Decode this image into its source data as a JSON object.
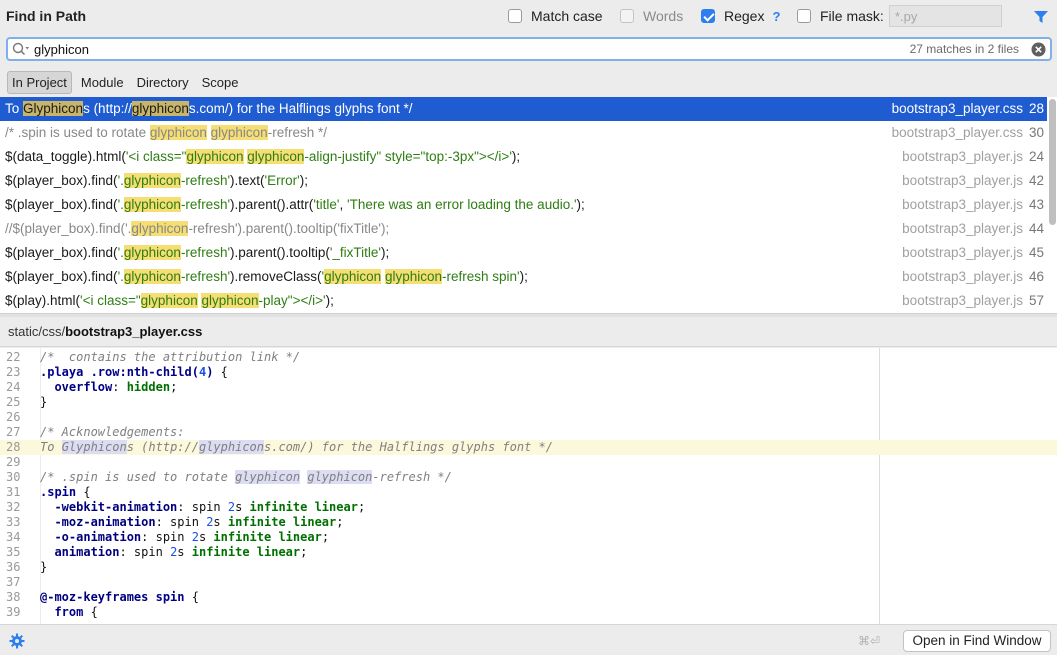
{
  "header": {
    "title": "Find in Path",
    "options": {
      "match_case": {
        "label": "Match case",
        "checked": false
      },
      "words": {
        "label": "Words",
        "checked": false,
        "enabled": false
      },
      "regex": {
        "label": "Regex",
        "checked": true,
        "help": "?"
      },
      "file_mask": {
        "label": "File mask:",
        "checked": false,
        "placeholder": "*.py"
      }
    }
  },
  "search": {
    "value": "glyphicon",
    "match_count": "27 matches in 2 files"
  },
  "scopes": [
    {
      "label": "In Project",
      "active": true
    },
    {
      "label": "Module",
      "active": false
    },
    {
      "label": "Directory",
      "active": false
    },
    {
      "label": "Scope",
      "active": false
    }
  ],
  "results": [
    {
      "text": "To Glyphicons (http://glyphicons.com/) for the Halflings glyphs font */",
      "file": "bootstrap3_player.css",
      "line": "28",
      "selected": true
    },
    {
      "text": "/* .spin is used to rotate glyphicon glyphicon-refresh */",
      "file": "bootstrap3_player.css",
      "line": "30",
      "selected": false
    },
    {
      "text": "$(data_toggle).html('<i class=\"glyphicon glyphicon-align-justify\" style=\"top:-3px\"></i>');",
      "file": "bootstrap3_player.js",
      "line": "24",
      "selected": false
    },
    {
      "text": "$(player_box).find('.glyphicon-refresh').text('Error');",
      "file": "bootstrap3_player.js",
      "line": "42",
      "selected": false
    },
    {
      "text": "$(player_box).find('.glyphicon-refresh').parent().attr('title', 'There was an error loading the audio.');",
      "file": "bootstrap3_player.js",
      "line": "43",
      "selected": false
    },
    {
      "text": "//$(player_box).find('.glyphicon-refresh').parent().tooltip('fixTitle');",
      "file": "bootstrap3_player.js",
      "line": "44",
      "selected": false
    },
    {
      "text": "$(player_box).find('.glyphicon-refresh').parent().tooltip('_fixTitle');",
      "file": "bootstrap3_player.js",
      "line": "45",
      "selected": false
    },
    {
      "text": "$(player_box).find('.glyphicon-refresh').removeClass('glyphicon glyphicon-refresh spin');",
      "file": "bootstrap3_player.js",
      "line": "46",
      "selected": false
    },
    {
      "text": "$(play).html('<i class=\"glyphicon glyphicon-play\"></i>');",
      "file": "bootstrap3_player.js",
      "line": "57",
      "selected": false
    }
  ],
  "preview": {
    "path_prefix": "static/css/",
    "path_file": "bootstrap3_player.css",
    "current_line": "28",
    "lines": [
      {
        "n": "22",
        "code": "/*  contains the attribution link */"
      },
      {
        "n": "23",
        "code": ".playa .row:nth-child(4) {"
      },
      {
        "n": "24",
        "code": "  overflow: hidden;"
      },
      {
        "n": "25",
        "code": "}"
      },
      {
        "n": "26",
        "code": ""
      },
      {
        "n": "27",
        "code": "/* Acknowledgements:"
      },
      {
        "n": "28",
        "code": "To Glyphicons (http://glyphicons.com/) for the Halflings glyphs font */"
      },
      {
        "n": "29",
        "code": ""
      },
      {
        "n": "30",
        "code": "/* .spin is used to rotate glyphicon glyphicon-refresh */"
      },
      {
        "n": "31",
        "code": ".spin {"
      },
      {
        "n": "32",
        "code": "  -webkit-animation: spin 2s infinite linear;"
      },
      {
        "n": "33",
        "code": "  -moz-animation: spin 2s infinite linear;"
      },
      {
        "n": "34",
        "code": "  -o-animation: spin 2s infinite linear;"
      },
      {
        "n": "35",
        "code": "  animation: spin 2s infinite linear;"
      },
      {
        "n": "36",
        "code": "}"
      },
      {
        "n": "37",
        "code": ""
      },
      {
        "n": "38",
        "code": "@-moz-keyframes spin {"
      },
      {
        "n": "39",
        "code": "  from {"
      }
    ]
  },
  "footer": {
    "shortcut": "⌘⏎",
    "open_button": "Open in Find Window"
  },
  "colors": {
    "accent": "#1f5cd1",
    "highlight": "#f5de74",
    "checkbox": "#2d7ff0"
  }
}
